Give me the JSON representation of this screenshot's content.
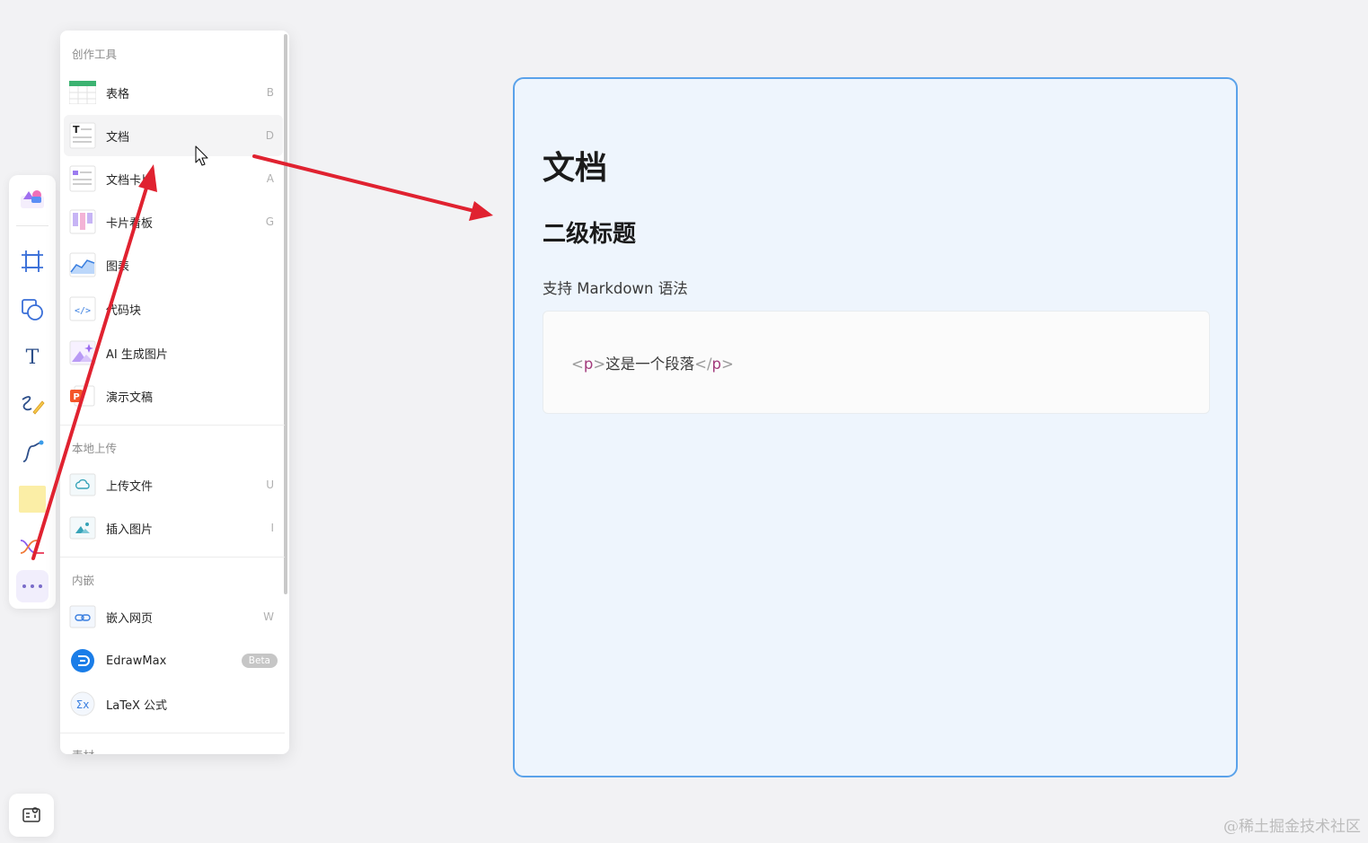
{
  "toolbar": {
    "tools": [
      "apps-icon",
      "frame-icon",
      "shape-icon",
      "text-icon",
      "pen-icon",
      "connector-icon",
      "sticky-note-icon",
      "mindmap-icon",
      "more-icon"
    ]
  },
  "menu": {
    "sections": {
      "create": "创作工具",
      "upload": "本地上传",
      "embed": "内嵌",
      "material": "素材"
    },
    "items": {
      "table": {
        "label": "表格",
        "key": "B"
      },
      "doc": {
        "label": "文档",
        "key": "D"
      },
      "doc_card": {
        "label": "文档卡片",
        "key": "A"
      },
      "kanban": {
        "label": "卡片看板",
        "key": "G"
      },
      "chart": {
        "label": "图表",
        "key": ""
      },
      "code": {
        "label": "代码块",
        "key": ""
      },
      "ai_image": {
        "label": "AI 生成图片",
        "key": ""
      },
      "ppt": {
        "label": "演示文稿",
        "key": ""
      },
      "upload_file": {
        "label": "上传文件",
        "key": "U"
      },
      "insert_image": {
        "label": "插入图片",
        "key": "I"
      },
      "embed_web": {
        "label": "嵌入网页",
        "key": "W"
      },
      "edrawmax": {
        "label": "EdrawMax",
        "badge": "Beta"
      },
      "latex": {
        "label": "LaTeX 公式",
        "key": ""
      }
    }
  },
  "doc": {
    "title": "文档",
    "heading2": "二级标题",
    "paragraph": "支持 Markdown 语法",
    "code": {
      "open_lt": "<",
      "open_tag": "p",
      "open_gt": ">",
      "text": "这是一个段落",
      "close_lt": "</",
      "close_tag": "p",
      "close_gt": ">"
    }
  },
  "colors": {
    "arrow": "#e02230",
    "card_border": "#5aa2ea",
    "card_bg": "#eef5fd"
  },
  "watermark": "@稀土掘金技术社区"
}
